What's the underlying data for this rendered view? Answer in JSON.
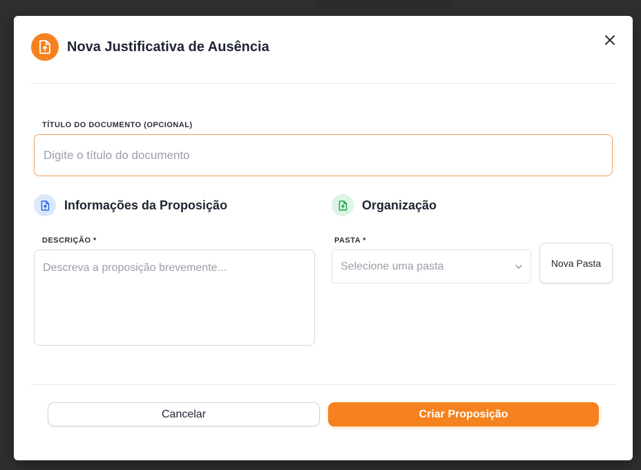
{
  "modal": {
    "title": "Nova Justificativa de Ausência",
    "header_icon": "file-upload-icon",
    "close_icon": "close-icon"
  },
  "document_title": {
    "label": "TÍTULO DO DOCUMENTO (OPCIONAL)",
    "placeholder": "Digite o título do documento",
    "value": ""
  },
  "proposition_info": {
    "heading": "Informações da Proposição",
    "icon": "file-upload-icon",
    "description_label": "DESCRIÇÃO *",
    "description_placeholder": "Descreva a proposição brevemente...",
    "description_value": ""
  },
  "organization": {
    "heading": "Organização",
    "icon": "file-upload-icon",
    "folder_label": "PASTA *",
    "folder_placeholder": "Selecione uma pasta",
    "new_folder_label": "Nova Pasta"
  },
  "footer": {
    "cancel_label": "Cancelar",
    "create_label": "Criar Proposição"
  },
  "colors": {
    "accent": "#f5821f",
    "info_icon_bg": "#dbe8fb",
    "info_icon_fg": "#2563eb",
    "org_icon_bg": "#dcf5e4",
    "org_icon_fg": "#16a34a"
  }
}
